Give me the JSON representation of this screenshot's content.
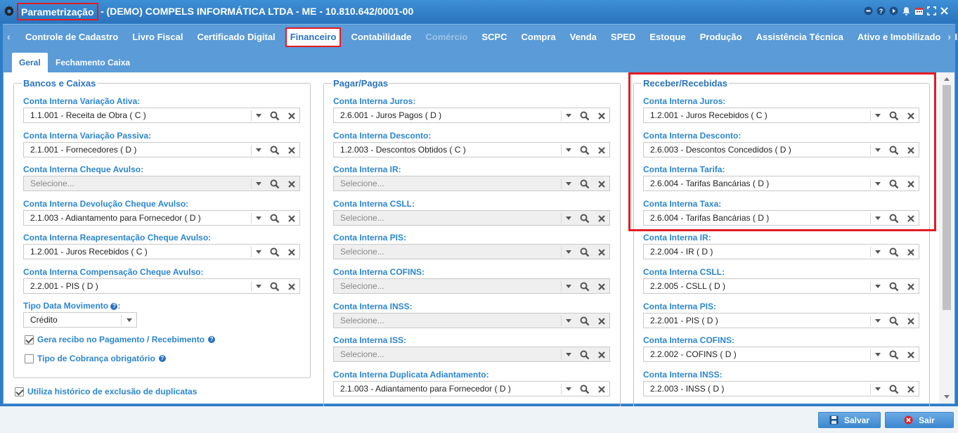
{
  "window": {
    "title": "Parametrização",
    "subtitle": "- (DEMO) COMPELS INFORMÁTICA LTDA - ME - 10.810.642/0001-00"
  },
  "module_tabs": [
    {
      "label": "Controle de Cadastro",
      "state": "normal"
    },
    {
      "label": "Livro Fiscal",
      "state": "normal"
    },
    {
      "label": "Certificado Digital",
      "state": "normal"
    },
    {
      "label": "Financeiro",
      "state": "active"
    },
    {
      "label": "Contabilidade",
      "state": "normal"
    },
    {
      "label": "Comércio",
      "state": "disabled"
    },
    {
      "label": "SCPC",
      "state": "normal"
    },
    {
      "label": "Compra",
      "state": "normal"
    },
    {
      "label": "Venda",
      "state": "normal"
    },
    {
      "label": "SPED",
      "state": "normal"
    },
    {
      "label": "Estoque",
      "state": "normal"
    },
    {
      "label": "Produção",
      "state": "normal"
    },
    {
      "label": "Assistência Técnica",
      "state": "normal"
    },
    {
      "label": "Ativo e Imobilizado",
      "state": "normal"
    },
    {
      "label": "Integraçõ",
      "state": "normal"
    }
  ],
  "sub_tabs": [
    {
      "label": "Geral",
      "active": true
    },
    {
      "label": "Fechamento Caixa",
      "active": false
    }
  ],
  "bancos": {
    "legend": "Bancos e Caixas",
    "fields": [
      {
        "label": "Conta Interna Variação Ativa:",
        "value": "1.1.001 - Receita de Obra ( C )"
      },
      {
        "label": "Conta Interna Variação Passiva:",
        "value": "2.1.001 - Fornecedores ( D )"
      },
      {
        "label": "Conta Interna Cheque Avulso:",
        "value": "Selecione..."
      },
      {
        "label": "Conta Interna Devolução Cheque Avulso:",
        "value": "2.1.003 - Adiantamento para Fornecedor ( D )"
      },
      {
        "label": "Conta Interna Reapresentação Cheque Avulso:",
        "value": "1.2.001 - Juros Recebidos ( C )"
      },
      {
        "label": "Conta Interna Compensação Cheque Avulso:",
        "value": "2.2.001 - PIS ( D )"
      }
    ],
    "tipo_data_label": "Tipo Data Movimento",
    "tipo_data_colon": ":",
    "tipo_data_value": "Crédito",
    "checks": [
      {
        "label": "Gera recibo no Pagamento / Recebimento",
        "checked": true
      },
      {
        "label": "Tipo de Cobrança obrigatório",
        "checked": false
      }
    ]
  },
  "utiliza_historico": {
    "label": "Utiliza histórico de exclusão de duplicatas",
    "checked": true
  },
  "pagar": {
    "legend": "Pagar/Pagas",
    "fields": [
      {
        "label": "Conta Interna Juros:",
        "value": "2.6.001 - Juros Pagos ( D )"
      },
      {
        "label": "Conta Interna Desconto:",
        "value": "1.2.003 - Descontos Obtidos ( C )"
      },
      {
        "label": "Conta Interna IR:",
        "value": "Selecione..."
      },
      {
        "label": "Conta Interna CSLL:",
        "value": "Selecione..."
      },
      {
        "label": "Conta Interna PIS:",
        "value": "Selecione..."
      },
      {
        "label": "Conta Interna COFINS:",
        "value": "Selecione..."
      },
      {
        "label": "Conta Interna INSS:",
        "value": "Selecione..."
      },
      {
        "label": "Conta Interna ISS:",
        "value": "Selecione..."
      },
      {
        "label": "Conta Interna Duplicata Adiantamento:",
        "value": "2.1.003 - Adiantamento para Fornecedor ( D )"
      }
    ]
  },
  "receber": {
    "legend": "Receber/Recebidas",
    "fields": [
      {
        "label": "Conta Interna Juros:",
        "value": "1.2.001 - Juros Recebidos ( C )"
      },
      {
        "label": "Conta Interna Desconto:",
        "value": "2.6.003 - Descontos Concedidos ( D )"
      },
      {
        "label": "Conta Interna Tarifa:",
        "value": "2.6.004 - Tarifas Bancárias ( D )"
      },
      {
        "label": "Conta Interna Taxa:",
        "value": "2.6.004 - Tarifas Bancárias ( D )"
      },
      {
        "label": "Conta Interna IR:",
        "value": "2.2.004 - IR ( D )"
      },
      {
        "label": "Conta Interna CSLL:",
        "value": "2.2.005 - CSLL ( D )"
      },
      {
        "label": "Conta Interna PIS:",
        "value": "2.2.001 - PIS ( D )"
      },
      {
        "label": "Conta Interna COFINS:",
        "value": "2.2.002 - COFINS ( D )"
      },
      {
        "label": "Conta Interna INSS:",
        "value": "2.2.003 - INSS ( D )"
      }
    ]
  },
  "placeholder_text": "Selecione...",
  "footer": {
    "save_label": "Salvar",
    "exit_label": "Sair"
  },
  "colors": {
    "accent": "#2b74bd",
    "label": "#2b86cf",
    "highlight": "#e41b23"
  }
}
